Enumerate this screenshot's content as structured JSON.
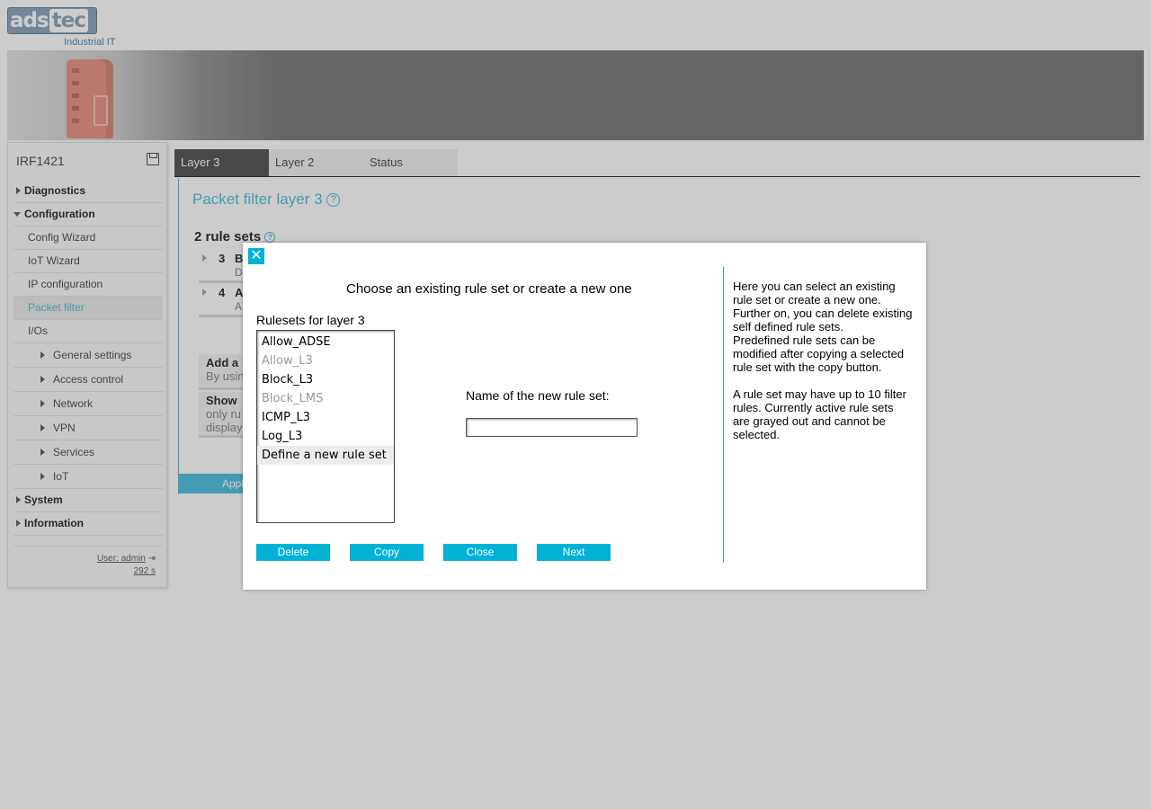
{
  "logo": {
    "brand_a": "ads",
    "brand_b": "tec",
    "tagline": "Industrial IT"
  },
  "sidebar": {
    "device_name": "IRF1421",
    "sections": {
      "diagnostics": "Diagnostics",
      "configuration": "Configuration",
      "system": "System",
      "information": "Information"
    },
    "config_items": {
      "config_wizard": "Config Wizard",
      "iot_wizard": "IoT Wizard",
      "ip_configuration": "IP configuration",
      "packet_filter": "Packet filter",
      "ios": "I/Os"
    },
    "sub_items": {
      "general_settings": "General settings",
      "access_control": "Access control",
      "network": "Network",
      "vpn": "VPN",
      "services": "Services",
      "iot": "IoT"
    },
    "user": "User: admin",
    "session": "292 s"
  },
  "tabs": {
    "layer3": "Layer 3",
    "layer2": "Layer 2",
    "status": "Status"
  },
  "content": {
    "title": "Packet filter layer 3",
    "ruleset_count": "2 rule sets",
    "rows": [
      {
        "num": "3",
        "title": "B",
        "desc": "D"
      },
      {
        "num": "4",
        "title": "A",
        "desc": "A"
      }
    ],
    "add_heading": "Add a",
    "add_body": "By usin",
    "show_heading": "Show",
    "show_body_1": "only ru",
    "show_body_2": "display",
    "apply": "Appl"
  },
  "modal": {
    "heading": "Choose an existing rule set or create a new one",
    "rulesets_label": "Rulesets for layer 3",
    "rulesets": [
      {
        "name": "Allow_ADSE",
        "disabled": false,
        "selected": false
      },
      {
        "name": "Allow_L3",
        "disabled": true,
        "selected": false
      },
      {
        "name": "Block_L3",
        "disabled": false,
        "selected": false
      },
      {
        "name": "Block_LMS",
        "disabled": true,
        "selected": false
      },
      {
        "name": "ICMP_L3",
        "disabled": false,
        "selected": false
      },
      {
        "name": "Log_L3",
        "disabled": false,
        "selected": false
      },
      {
        "name": "Define a new rule set",
        "disabled": false,
        "selected": true
      }
    ],
    "new_name_label": "Name of the new rule set:",
    "new_name_value": "",
    "buttons": {
      "delete": "Delete",
      "copy": "Copy",
      "close": "Close",
      "next": "Next"
    },
    "help_lines_1": [
      "Here you can select an existing",
      "rule set or create a new one.",
      "Further on, you can delete existing",
      "self defined rule sets.",
      "Predefined rule sets can be",
      "modified after copying a selected",
      "rule set with the copy button."
    ],
    "help_lines_2": [
      "A rule set may have up to 10 filter",
      "rules. Currently active rule sets",
      "are grayed out and cannot be",
      "selected."
    ]
  },
  "colors": {
    "accent": "#00b2d6",
    "link": "#56c2df",
    "active_tab": "#5b5b5b"
  }
}
